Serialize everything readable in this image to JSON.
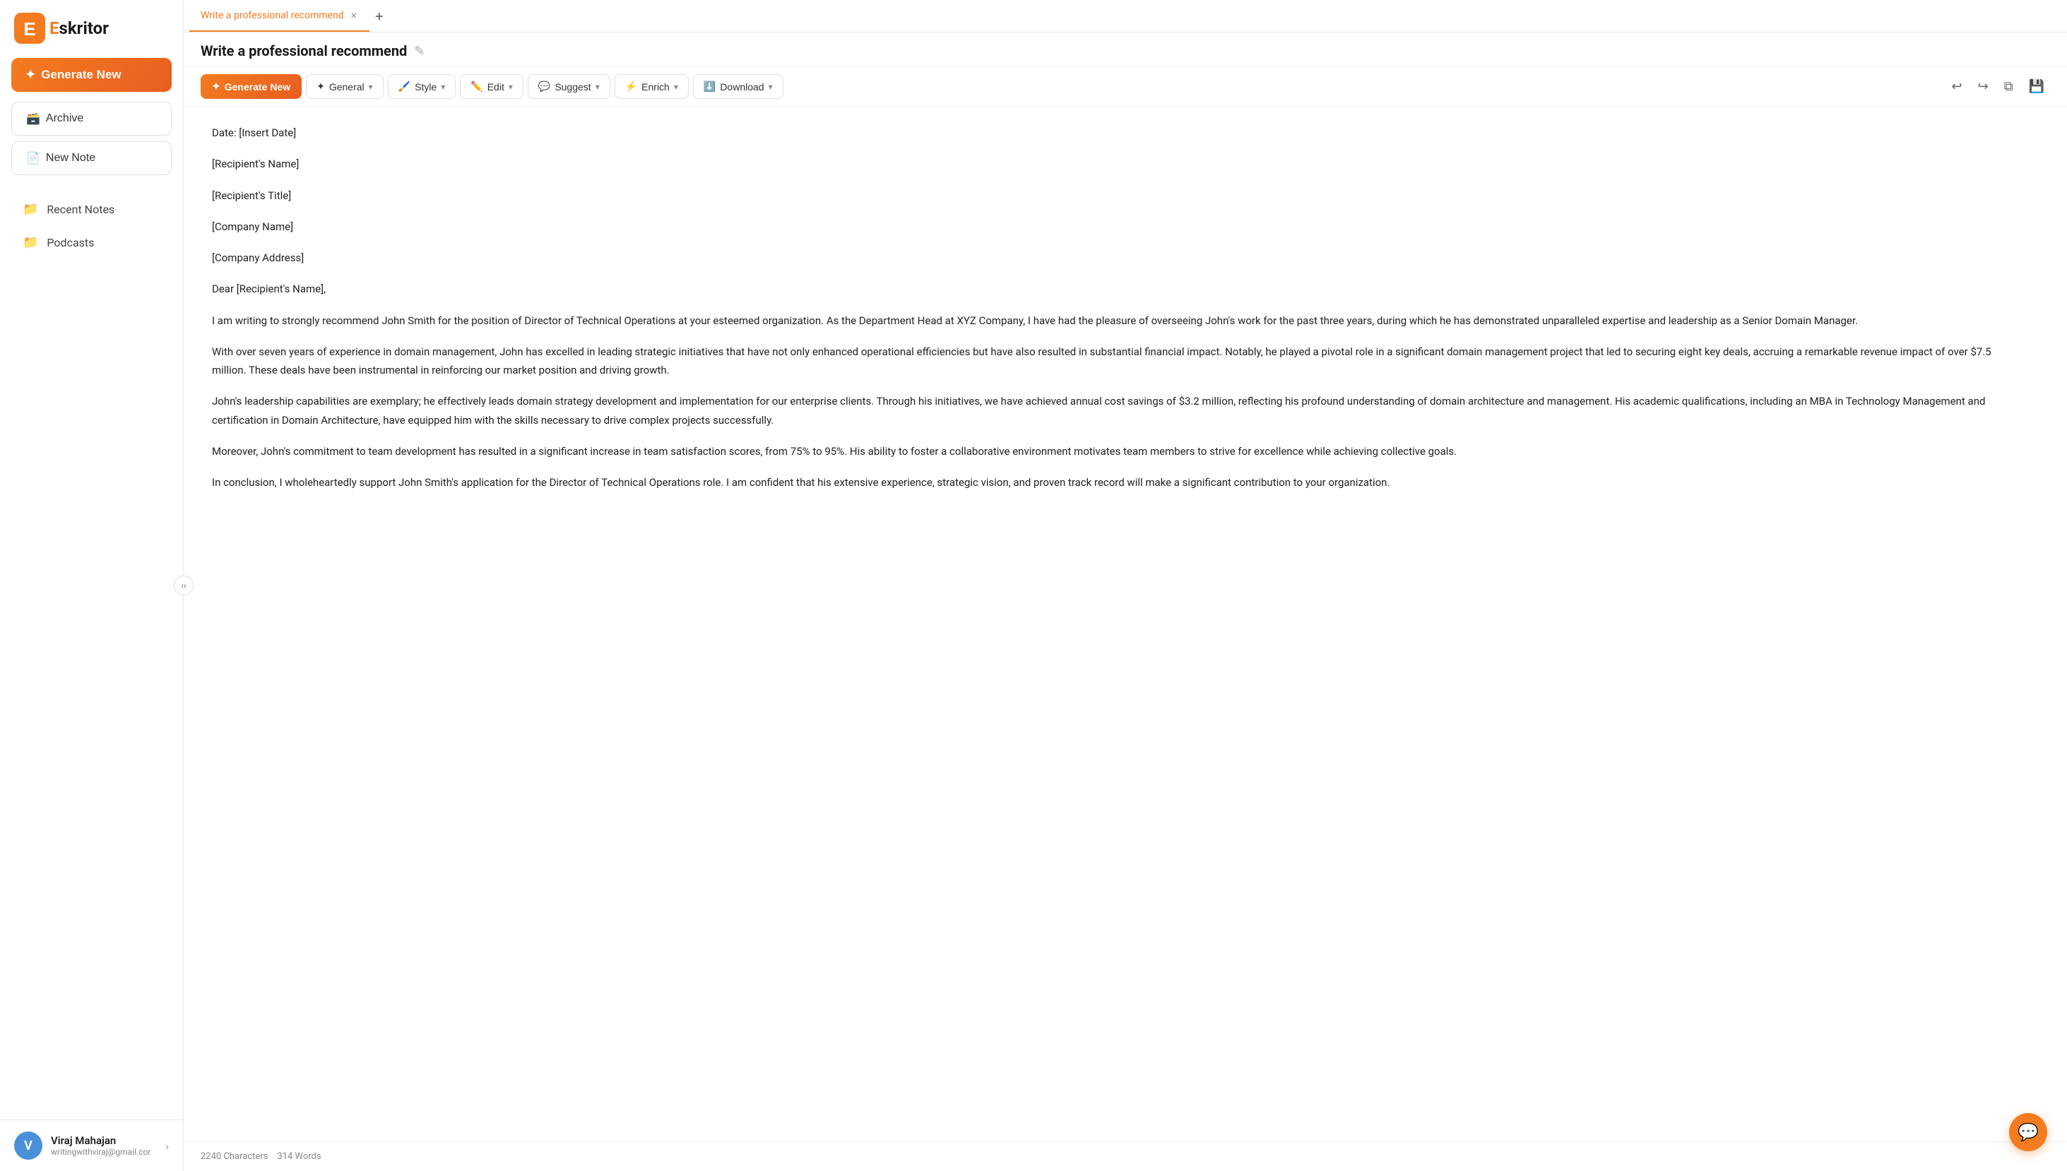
{
  "brand": {
    "name": "Eskritor",
    "logo_letter": "E",
    "logo_rest": "skritor"
  },
  "sidebar": {
    "generate_new_label": "Generate New",
    "archive_label": "Archive",
    "new_note_label": "New Note",
    "nav_items": [
      {
        "id": "recent-notes",
        "label": "Recent Notes",
        "icon": "📁"
      },
      {
        "id": "podcasts",
        "label": "Podcasts",
        "icon": "📁"
      }
    ],
    "user": {
      "initial": "V",
      "name": "Viraj Mahajan",
      "email": "writingwithviraj@gmail.cor"
    }
  },
  "tabs": [
    {
      "id": "main-tab",
      "label": "Write a professional recommend",
      "active": true
    }
  ],
  "document": {
    "title": "Write a professional recommend",
    "toolbar": {
      "generate_new": "Generate New",
      "general": "General",
      "style": "Style",
      "edit": "Edit",
      "suggest": "Suggest",
      "enrich": "Enrich",
      "download": "Download"
    },
    "content": {
      "lines": [
        "Date: [Insert Date]",
        "[Recipient's Name]",
        "[Recipient's Title]",
        "[Company Name]",
        "[Company Address]",
        "Dear [Recipient's Name],",
        "I am writing to strongly recommend John Smith for the position of Director of Technical Operations at your esteemed organization. As the Department Head at XYZ Company, I have had the pleasure of overseeing John's work for the past three years, during which he has demonstrated unparalleled expertise and leadership as a Senior Domain Manager.",
        "With over seven years of experience in domain management, John has excelled in leading strategic initiatives that have not only enhanced operational efficiencies but have also resulted in substantial financial impact. Notably, he played a pivotal role in a significant domain management project that led to securing eight key deals, accruing a remarkable revenue impact of over $7.5 million. These deals have been instrumental in reinforcing our market position and driving growth.",
        "John's leadership capabilities are exemplary; he effectively leads domain strategy development and implementation for our enterprise clients. Through his initiatives, we have achieved annual cost savings of $3.2 million, reflecting his profound understanding of domain architecture and management. His academic qualifications, including an MBA in Technology Management and certification in Domain Architecture, have equipped him with the skills necessary to drive complex projects successfully.",
        "Moreover, John's commitment to team development has resulted in a significant increase in team satisfaction scores, from 75% to 95%. His ability to foster a collaborative environment motivates team members to strive for excellence while achieving collective goals.",
        "In conclusion, I wholeheartedly support John Smith's application for the Director of Technical Operations role. I am confident that his extensive experience, strategic vision, and proven track record will make a significant contribution to your organization."
      ]
    },
    "status": {
      "characters": "2240 Characters",
      "words": "314 Words"
    }
  }
}
